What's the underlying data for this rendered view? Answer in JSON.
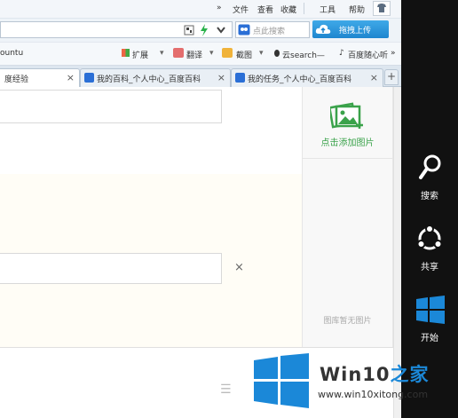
{
  "menu": {
    "items": [
      "文件",
      "查看",
      "收藏",
      "工具",
      "帮助"
    ],
    "arrows": "»"
  },
  "address": {
    "search_placeholder": "点此搜索",
    "upload_label": "拖拽上传"
  },
  "bookmarks": {
    "first": "ountu",
    "items": [
      "扩展",
      "翻译",
      "截图",
      "云search—",
      "百度随心听"
    ],
    "more": "»"
  },
  "tabs": [
    {
      "label": "度经验",
      "active": true
    },
    {
      "label": "我的百科_个人中心_百度百科",
      "active": false
    },
    {
      "label": "我的任务_个人中心_百度百科",
      "active": false
    }
  ],
  "tab_close": "×",
  "content": {
    "add_image_label": "点击添加图片",
    "no_image_label": "图库暂无图片",
    "close_symbol": "×",
    "list_icon": "☰"
  },
  "charms": {
    "search_label": "搜索",
    "share_label": "共享",
    "start_label": "开始"
  },
  "watermark": {
    "name_part1": "Win10",
    "name_part2": "之家",
    "url": "www.win10xitong.com"
  },
  "colors": {
    "accent_blue": "#1e86cf",
    "green": "#3aa24a",
    "charm_bg": "#111111",
    "windows_blue": "#1b88d8"
  }
}
